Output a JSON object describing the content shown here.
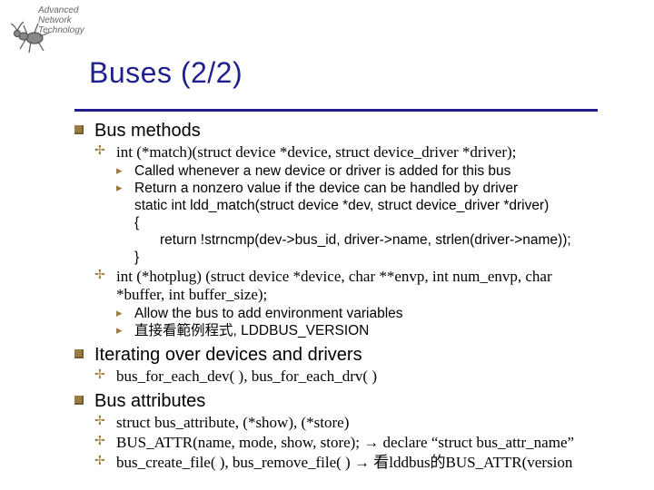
{
  "logo": {
    "line1": "Advanced",
    "line2": "Network",
    "line3": "Technology"
  },
  "title": "Buses (2/2)",
  "sections": {
    "bus_methods": {
      "heading": "Bus methods",
      "match": {
        "sig": "int (*match)(struct device *device, struct device_driver *driver);",
        "b1": "Called whenever a new device or driver is added for this bus",
        "b2": "Return a nonzero value if the device can be handled by driver",
        "code0": "static int ldd_match(struct device *dev, struct device_driver *driver)",
        "code1": "{",
        "code2": "return !strncmp(dev->bus_id, driver->name, strlen(driver->name));",
        "code3": "}"
      },
      "hotplug": {
        "sig": "int (*hotplug) (struct device *device, char **envp, int num_envp, char *buffer, int buffer_size);",
        "b1": "Allow the bus to add environment variables",
        "b2": "直接看範例程式, LDDBUS_VERSION"
      }
    },
    "iterating": {
      "heading": "Iterating over devices and drivers",
      "line": "bus_for_each_dev( ),  bus_for_each_drv( )"
    },
    "attrs": {
      "heading": "Bus attributes",
      "a1": "struct bus_attribute, (*show), (*store)",
      "a2": "BUS_ATTR(name, mode, show, store); → declare “struct bus_attr_name”",
      "a3": "bus_create_file( ),  bus_remove_file( ) → 看lddbus的BUS_ATTR(version"
    }
  }
}
